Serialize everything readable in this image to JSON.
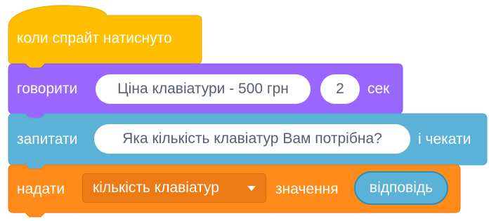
{
  "script": {
    "hat": {
      "label": "коли спрайт натиснуто",
      "color": "#ffbf00"
    },
    "say": {
      "label": "говорити",
      "message": "Ціна клавіатури - 500 грн",
      "seconds": "2",
      "unit": "сек",
      "color": "#9966ff"
    },
    "ask": {
      "label": "запитати",
      "question": "Яка кількість клавіатур Вам потрібна?",
      "suffix": "і чекати",
      "color": "#5cb1d6"
    },
    "set": {
      "label": "надати",
      "variable": "кількість клавіатур",
      "value_label": "значення",
      "reporter": "відповідь",
      "color": "#ff8c1a"
    }
  }
}
